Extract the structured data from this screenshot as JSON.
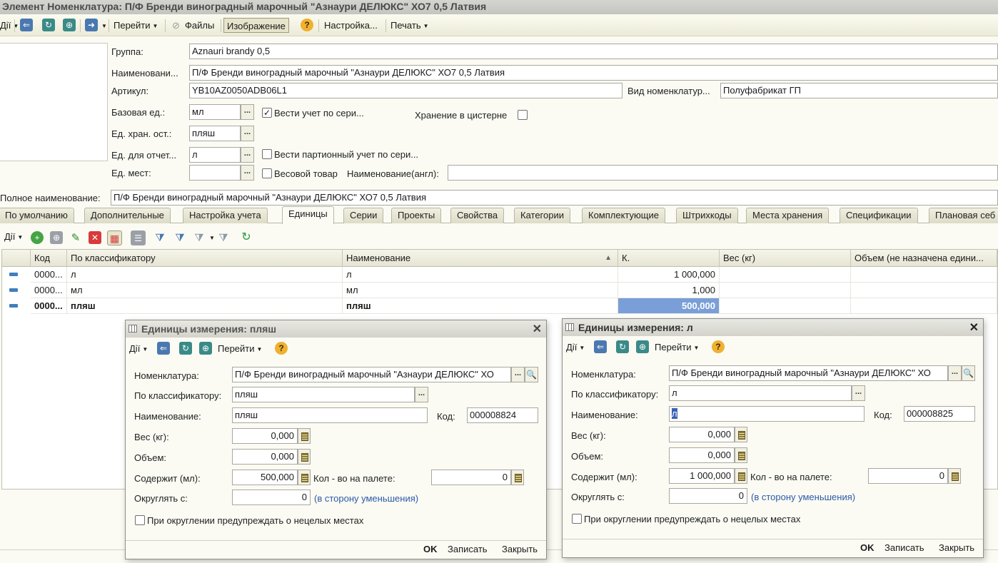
{
  "window": {
    "title": "Элемент Номенклатура: П/Ф Бренди виноградный марочный \"Азнаури ДЕЛЮКС\" ХО7 0,5 Латвия"
  },
  "toolbar": {
    "actions_label": "Дії",
    "goto_label": "Перейти",
    "files_label": "Файлы",
    "image_label": "Изображение",
    "settings_label": "Настройка...",
    "print_label": "Печать"
  },
  "form": {
    "group_label": "Группа:",
    "group_value": "Aznauri brandy 0,5",
    "name_label": "Наименовани...",
    "name_value": "П/Ф Бренди виноградный марочный \"Азнаури ДЕЛЮКС\" ХО7 0,5 Латвия",
    "article_label": "Артикул:",
    "article_value": "YB10AZ0050ADB06L1",
    "kind_label": "Вид номенклатур...",
    "kind_value": "Полуфабрикат ГП",
    "base_unit_label": "Базовая ед.:",
    "base_unit_value": "мл",
    "series_label": "Вести учет по сери...",
    "series_checked": "✓",
    "tank_label": "Хранение в цистерне",
    "storage_unit_label": "Ед. хран. ост.:",
    "storage_unit_value": "пляш",
    "report_unit_label": "Ед. для отчет...",
    "report_unit_value": "л",
    "batch_label": "Вести партионный учет по сери...",
    "place_unit_label": "Ед. мест:",
    "place_unit_value": "",
    "weight_goods_label": "Весовой товар",
    "name_en_label": "Наименование(англ):",
    "name_en_value": "",
    "full_name_label": "Полное наименование:",
    "full_name_value": "П/Ф Бренди виноградный марочный \"Азнаури ДЕЛЮКС\" ХО7 0,5 Латвия"
  },
  "tabs": [
    "По умолчанию",
    "Дополнительные",
    "Настройка учета",
    "Единицы",
    "Серии",
    "Проекты",
    "Свойства",
    "Категории",
    "Комплектующие",
    "Штрихкоды",
    "Места хранения",
    "Спецификации",
    "Плановая себ"
  ],
  "subtoolbar": {
    "actions_label": "Дії"
  },
  "units_table": {
    "columns": [
      "Код",
      "По классификатору",
      "Наименование",
      "К.",
      "Вес (кг)",
      "Объем (не назначена едини..."
    ],
    "rows": [
      {
        "code": "0000...",
        "classifier": "л",
        "name": "л",
        "k": "1 000,000",
        "weight": "",
        "volume": ""
      },
      {
        "code": "0000...",
        "classifier": "мл",
        "name": "мл",
        "k": "1,000",
        "weight": "",
        "volume": ""
      },
      {
        "code": "0000...",
        "classifier": "пляш",
        "name": "пляш",
        "k": "500,000",
        "weight": "",
        "volume": ""
      }
    ]
  },
  "dialog_left": {
    "title": "Единицы измерения: пляш",
    "actions_label": "Дії",
    "goto_label": "Перейти",
    "nomenclature_label": "Номенклатура:",
    "nomenclature_value": "П/Ф Бренди виноградный марочный \"Азнаури ДЕЛЮКС\" ХО",
    "classifier_label": "По классификатору:",
    "classifier_value": "пляш",
    "name_label": "Наименование:",
    "name_value": "пляш",
    "code_label": "Код:",
    "code_value": "000008824",
    "weight_label": "Вес (кг):",
    "weight_value": "0,000",
    "volume_label": "Объем:",
    "volume_value": "0,000",
    "contains_label": "Содержит (мл):",
    "contains_value": "500,000",
    "pallet_label": "Кол - во на палете:",
    "pallet_value": "0",
    "round_label": "Округлять с:",
    "round_value": "0",
    "round_mode": "(в сторону уменьшения)",
    "warn_label": "При округлении предупреждать о нецелых местах",
    "ok_label": "OK",
    "save_label": "Записать",
    "close_label": "Закрыть"
  },
  "dialog_right": {
    "title": "Единицы измерения: л",
    "actions_label": "Дії",
    "goto_label": "Перейти",
    "nomenclature_label": "Номенклатура:",
    "nomenclature_value": "П/Ф Бренди виноградный марочный \"Азнаури ДЕЛЮКС\" ХО",
    "classifier_label": "По классификатору:",
    "classifier_value": "л",
    "name_label": "Наименование:",
    "name_value": "л",
    "code_label": "Код:",
    "code_value": "000008825",
    "weight_label": "Вес (кг):",
    "weight_value": "0,000",
    "volume_label": "Объем:",
    "volume_value": "0,000",
    "contains_label": "Содержит (мл):",
    "contains_value": "1 000,000",
    "pallet_label": "Кол - во на палете:",
    "pallet_value": "0",
    "round_label": "Округлять с:",
    "round_value": "0",
    "round_mode": "(в сторону уменьшения)",
    "warn_label": "При округлении предупреждать о нецелых местах",
    "ok_label": "OK",
    "save_label": "Записать",
    "close_label": "Закрыть"
  }
}
